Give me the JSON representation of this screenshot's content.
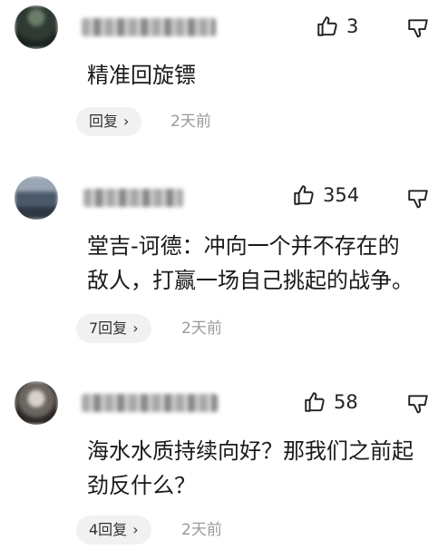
{
  "comments": [
    {
      "like_count": "3",
      "text": "精准回旋镖",
      "reply_label": "回复",
      "time": "2天前",
      "username_hidden": true
    },
    {
      "like_count": "354",
      "text": "堂吉-诃德：冲向一个并不存在的\n敌人，打赢一场自己挑起的战争。",
      "reply_label": "7回复",
      "time": "2天前",
      "username_hidden": true
    },
    {
      "like_count": "58",
      "text": "海水水质持续向好？那我们之前起\n劲反什么？",
      "reply_label": "4回复",
      "time": "2天前",
      "username_hidden": true
    }
  ],
  "icons": {
    "like": "thumbs-up-outline-icon",
    "dislike": "thumbs-down-outline-icon",
    "reply_chevron": "chevron-right-icon"
  },
  "colors": {
    "text": "#1a1a1a",
    "muted": "#9a9a9a",
    "reply_bg": "#f1f1f1"
  }
}
